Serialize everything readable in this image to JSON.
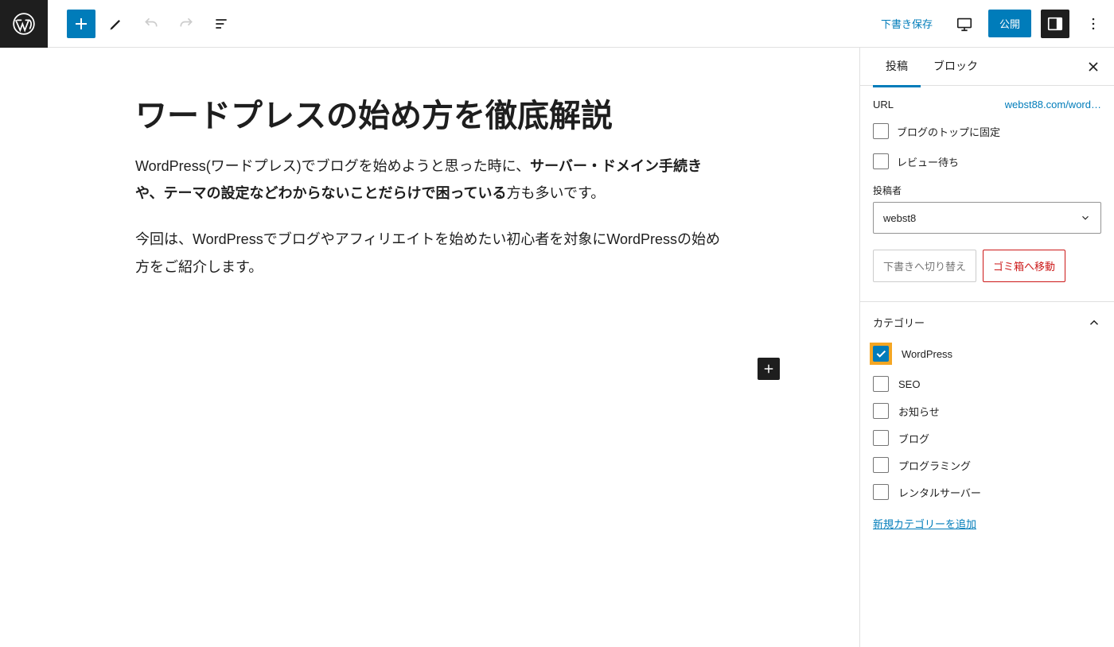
{
  "toolbar": {
    "save_draft": "下書き保存",
    "publish": "公開"
  },
  "post": {
    "title": "ワードプレスの始め方を徹底解説",
    "p1_pre": "WordPress(ワードプレス)でブログを始めようと思った時に、",
    "p1_bold": "サーバー・ドメイン手続きや、テーマの設定などわからないことだらけで困っている",
    "p1_post": "方も多いです。",
    "p2": "今回は、WordPressでブログやアフィリエイトを始めたい初心者を対象にWordPressの始め方をご紹介します。"
  },
  "sidebar": {
    "tabs": {
      "post": "投稿",
      "block": "ブロック"
    },
    "url_label": "URL",
    "url_value": "webst88.com/word…",
    "stick_top": "ブログのトップに固定",
    "pending_review": "レビュー待ち",
    "author_label": "投稿者",
    "author_value": "webst8",
    "switch_draft": "下書きへ切り替え",
    "move_trash": "ゴミ箱へ移動",
    "category_heading": "カテゴリー",
    "categories": [
      {
        "label": "WordPress",
        "checked": true,
        "highlight": true
      },
      {
        "label": "SEO",
        "checked": false
      },
      {
        "label": "お知らせ",
        "checked": false
      },
      {
        "label": "ブログ",
        "checked": false
      },
      {
        "label": "プログラミング",
        "checked": false
      },
      {
        "label": "レンタルサーバー",
        "checked": false
      }
    ],
    "add_category": "新規カテゴリーを追加"
  }
}
